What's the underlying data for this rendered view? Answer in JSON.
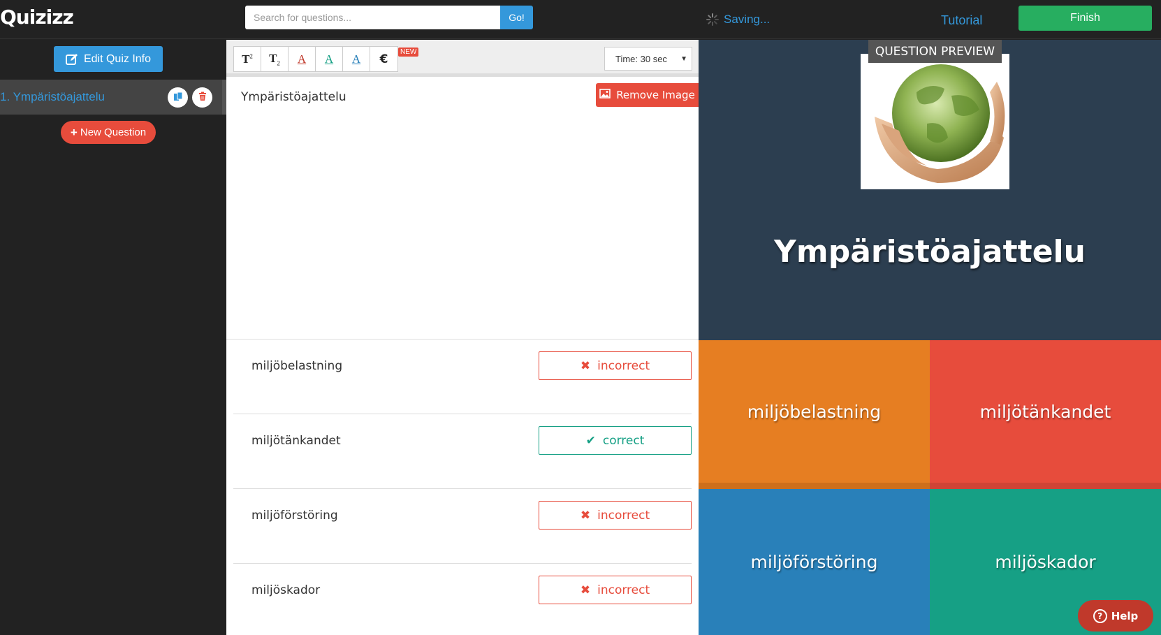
{
  "header": {
    "logo": "Quizizz",
    "search_placeholder": "Search for questions...",
    "go_label": "Go!",
    "saving_label": "Saving...",
    "tutorial_label": "Tutorial",
    "finish_label": "Finish"
  },
  "sidebar": {
    "edit_quiz_label": "Edit Quiz Info",
    "questions": [
      {
        "label": "1. Ympäristöajattelu"
      }
    ],
    "new_question_label": "New Question"
  },
  "editor": {
    "toolbar": {
      "new_badge": "NEW",
      "time_label": "Time: 30 sec"
    },
    "question_text": "Ympäristöajattelu",
    "remove_image_label": "Remove Image",
    "answers": [
      {
        "text": "miljöbelastning",
        "status": "incorrect",
        "status_icon": "x-icon"
      },
      {
        "text": "miljötänkandet",
        "status": "correct",
        "status_icon": "check-icon"
      },
      {
        "text": "miljöförstöring",
        "status": "incorrect",
        "status_icon": "x-icon"
      },
      {
        "text": "miljöskador",
        "status": "incorrect",
        "status_icon": "x-icon"
      }
    ]
  },
  "preview": {
    "label": "QUESTION PREVIEW",
    "question": "Ympäristöajattelu",
    "options": [
      "miljöbelastning",
      "miljötänkandet",
      "miljöförstöring",
      "miljöskador"
    ],
    "option_colors": [
      "#e67e22",
      "#e74c3c",
      "#2980b9",
      "#16a085"
    ],
    "help_label": "Help"
  },
  "colors": {
    "accent_blue": "#3498db",
    "finish_green": "#27ae60",
    "danger_red": "#e74c3c",
    "correct_teal": "#16a085",
    "preview_bg": "#2c3e50"
  }
}
